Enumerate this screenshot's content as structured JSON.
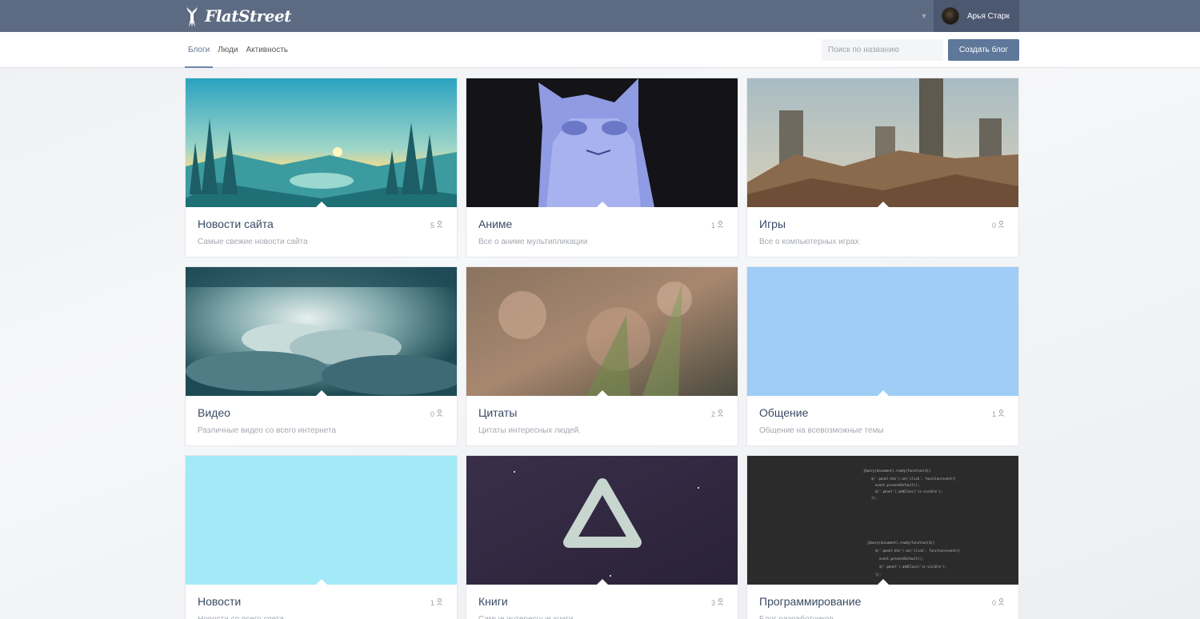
{
  "brand": {
    "name": "FlatStreet"
  },
  "user": {
    "name": "Арья Старк"
  },
  "nav": {
    "tabs": [
      {
        "label": "Блоги",
        "active": true
      },
      {
        "label": "Люди",
        "active": false
      },
      {
        "label": "Активность",
        "active": false
      }
    ],
    "search_placeholder": "Поиск по названию",
    "create_label": "Создать блог"
  },
  "blogs": [
    {
      "title": "Новости сайта",
      "count": "5",
      "description": "Самые свежие новости сайта",
      "cover": "landscape"
    },
    {
      "title": "Аниме",
      "count": "1",
      "description": "Все о аниме мультипликации",
      "cover": "cat"
    },
    {
      "title": "Игры",
      "count": "0",
      "description": "Все о компьютерных играх",
      "cover": "castle"
    },
    {
      "title": "Видео",
      "count": "0",
      "description": "Различные видео со всего интернета",
      "cover": "clouds"
    },
    {
      "title": "Цитаты",
      "count": "2",
      "description": "Цитаты интересных людей.",
      "cover": "bokeh"
    },
    {
      "title": "Общение",
      "count": "1",
      "description": "Общение на всевозможные темы",
      "cover": "solid-blue"
    },
    {
      "title": "Новости",
      "count": "1",
      "description": "Новости со всего света",
      "cover": "solid-cyan"
    },
    {
      "title": "Книги",
      "count": "3",
      "description": "Самые интересные книги",
      "cover": "triangle"
    },
    {
      "title": "Программирование",
      "count": "0",
      "description": "Блог разработчиков",
      "cover": "code"
    }
  ],
  "colors": {
    "topbar": "#5d6b82",
    "accent": "#5f7799"
  }
}
